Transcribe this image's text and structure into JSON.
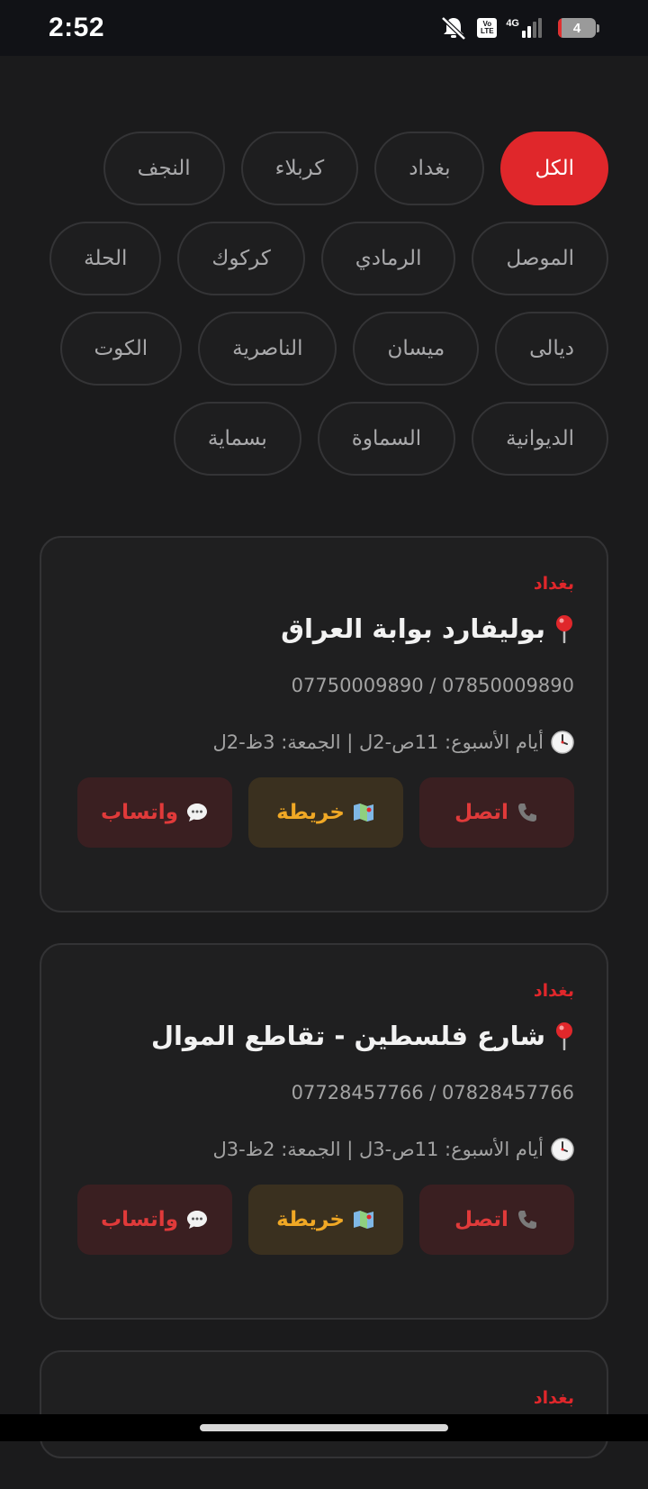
{
  "status_bar": {
    "time": "2:52",
    "network_label": "4G",
    "volte_label_top": "Vo",
    "volte_label_bottom": "LTE",
    "battery_level": "4",
    "icons": [
      "mute-icon",
      "volte-icon",
      "signal-icon",
      "battery-icon"
    ]
  },
  "filters": [
    {
      "label": "الكل",
      "active": true
    },
    {
      "label": "بغداد",
      "active": false
    },
    {
      "label": "كربلاء",
      "active": false
    },
    {
      "label": "النجف",
      "active": false
    },
    {
      "label": "الموصل",
      "active": false
    },
    {
      "label": "الرمادي",
      "active": false
    },
    {
      "label": "كركوك",
      "active": false
    },
    {
      "label": "الحلة",
      "active": false
    },
    {
      "label": "ديالى",
      "active": false
    },
    {
      "label": "ميسان",
      "active": false
    },
    {
      "label": "الناصرية",
      "active": false
    },
    {
      "label": "الكوت",
      "active": false
    },
    {
      "label": "الديوانية",
      "active": false
    },
    {
      "label": "السماوة",
      "active": false
    },
    {
      "label": "بسماية",
      "active": false
    }
  ],
  "cards": [
    {
      "city": "بغداد",
      "title": "بوليفارد بوابة العراق",
      "phones": "07750009890 / 07850009890",
      "hours": "أيام الأسبوع: 11ص-2ل | الجمعة: 3ظ-2ل",
      "call_label": "اتصل",
      "map_label": "خريطة",
      "whatsapp_label": "واتساب"
    },
    {
      "city": "بغداد",
      "title": "شارع فلسطين - تقاطع الموال",
      "phones": "07728457766 / 07828457766",
      "hours": "أيام الأسبوع: 11ص-3ل | الجمعة: 2ظ-3ل",
      "call_label": "اتصل",
      "map_label": "خريطة",
      "whatsapp_label": "واتساب"
    },
    {
      "city": "بغداد"
    }
  ],
  "colors": {
    "accent": "#e0272b",
    "map_button_text": "#f0a825",
    "background": "#1b1b1c"
  }
}
